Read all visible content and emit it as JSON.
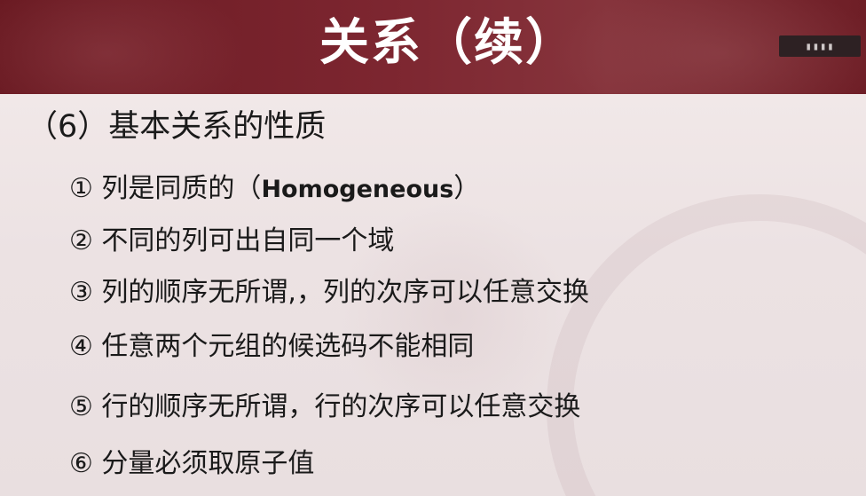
{
  "slide": {
    "title": "关系（续）",
    "heading": "（6）基本关系的性质",
    "items": [
      {
        "text_before": "① 列是同质的（",
        "text_en": "Homogeneous",
        "text_after": "）"
      },
      {
        "text": "② 不同的列可出自同一个域"
      },
      {
        "text": "③ 列的顺序无所谓,，列的次序可以任意交换"
      },
      {
        "text": "④ 任意两个元组的候选码不能相同"
      },
      {
        "text": "⑤ 行的顺序无所谓，行的次序可以任意交换"
      },
      {
        "text": "⑥ 分量必须取原子值"
      }
    ]
  },
  "logo": {
    "icon": "watermark-logo-icon"
  },
  "colors": {
    "title_band": "#7d2630",
    "title_text": "#ffffff",
    "body_background": "#ece2e3",
    "body_text": "#1a1a1a"
  }
}
